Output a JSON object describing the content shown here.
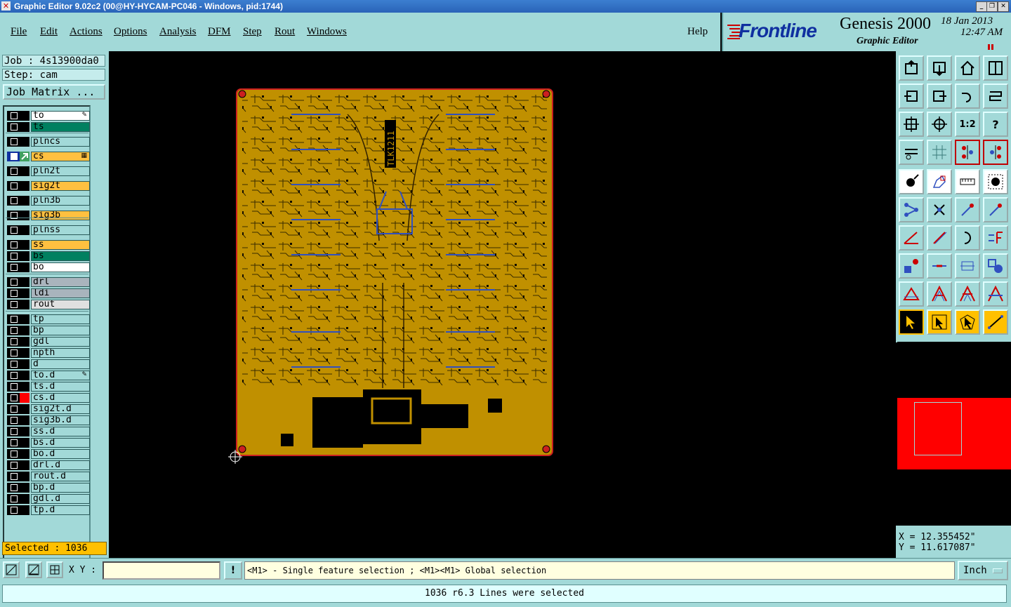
{
  "window": {
    "title": "Graphic Editor 9.02c2 (00@HY-HYCAM-PC046 - Windows, pid:1744)",
    "icon": "x-close-icon",
    "controls": [
      "minimize-icon",
      "restore-icon",
      "close-icon"
    ]
  },
  "menu": {
    "items": [
      "File",
      "Edit",
      "Actions",
      "Options",
      "Analysis",
      "DFM",
      "Step",
      "Rout",
      "Windows"
    ],
    "help": "Help"
  },
  "brand": {
    "logo": "Frontline",
    "product": "Genesis 2000",
    "subtitle": "Graphic Editor",
    "date": "18 Jan 2013",
    "time": "12:47 AM",
    "accent_color": "#cc0000"
  },
  "job": {
    "job_label": "Job : 4s13900da0",
    "step_label": "Step: cam",
    "matrix_button": "Job Matrix ..."
  },
  "layers": [
    {
      "name": "to",
      "color": "#ffffff",
      "mark": "pen-icon"
    },
    {
      "name": "ts",
      "color": "#008060"
    },
    {
      "name": "plncs",
      "color": "#a2d9d8"
    },
    {
      "name": "cs",
      "color": "#ffc040",
      "active": true,
      "mark": "grid-icon"
    },
    {
      "name": "pln2t",
      "color": "#a2d9d8"
    },
    {
      "name": "sig2t",
      "color": "#ffc040"
    },
    {
      "name": "pln3b",
      "color": "#a2d9d8"
    },
    {
      "name": "sig3b",
      "color": "#ffc040"
    },
    {
      "name": "plnss",
      "color": "#a2d9d8"
    },
    {
      "name": "ss",
      "color": "#ffc040"
    },
    {
      "name": "bs",
      "color": "#008060"
    },
    {
      "name": "bo",
      "color": "#ffffff"
    },
    {
      "name": "drl",
      "color": "#a9b4bd"
    },
    {
      "name": "ldi",
      "color": "#a9b4bd"
    },
    {
      "name": "rout",
      "color": "#e0e0e0"
    },
    {
      "name": "tp",
      "color": "#a2d9d8"
    },
    {
      "name": "bp",
      "color": "#a2d9d8"
    },
    {
      "name": "gdl",
      "color": "#a2d9d8"
    },
    {
      "name": "npth",
      "color": "#a2d9d8"
    },
    {
      "name": "d",
      "color": "#a2d9d8"
    },
    {
      "name": "to.d",
      "color": "#a2d9d8",
      "mark": "pen-icon"
    },
    {
      "name": "ts.d",
      "color": "#a2d9d8"
    },
    {
      "name": "cs.d",
      "color": "#a2d9d8",
      "flag": "#ff0000"
    },
    {
      "name": "sig2t.d",
      "color": "#a2d9d8"
    },
    {
      "name": "sig3b.d",
      "color": "#a2d9d8"
    },
    {
      "name": "ss.d",
      "color": "#a2d9d8"
    },
    {
      "name": "bs.d",
      "color": "#a2d9d8"
    },
    {
      "name": "bo.d",
      "color": "#a2d9d8"
    },
    {
      "name": "drl.d",
      "color": "#a2d9d8"
    },
    {
      "name": "rout.d",
      "color": "#a2d9d8"
    },
    {
      "name": "bp.d",
      "color": "#a2d9d8"
    },
    {
      "name": "gdl.d",
      "color": "#a2d9d8"
    },
    {
      "name": "tp.d",
      "color": "#a2d9d8"
    }
  ],
  "selection": {
    "label": "Selected : 1036"
  },
  "board": {
    "chip_label": "TLK1211",
    "board_color": "#c09000",
    "outline_color": "#cc2020"
  },
  "toolbox": {
    "label_1to2": "1:2",
    "label_help": "?"
  },
  "coordinates": {
    "x": "X = 12.355452\"",
    "y": "Y = 11.617087\""
  },
  "command": {
    "xy_label": "X Y :",
    "xy_value": "",
    "hint": "<M1> - Single feature selection ; <M1><M1> Global selection",
    "units": "Inch"
  },
  "status": {
    "message": "1036 r6.3 Lines were selected"
  }
}
